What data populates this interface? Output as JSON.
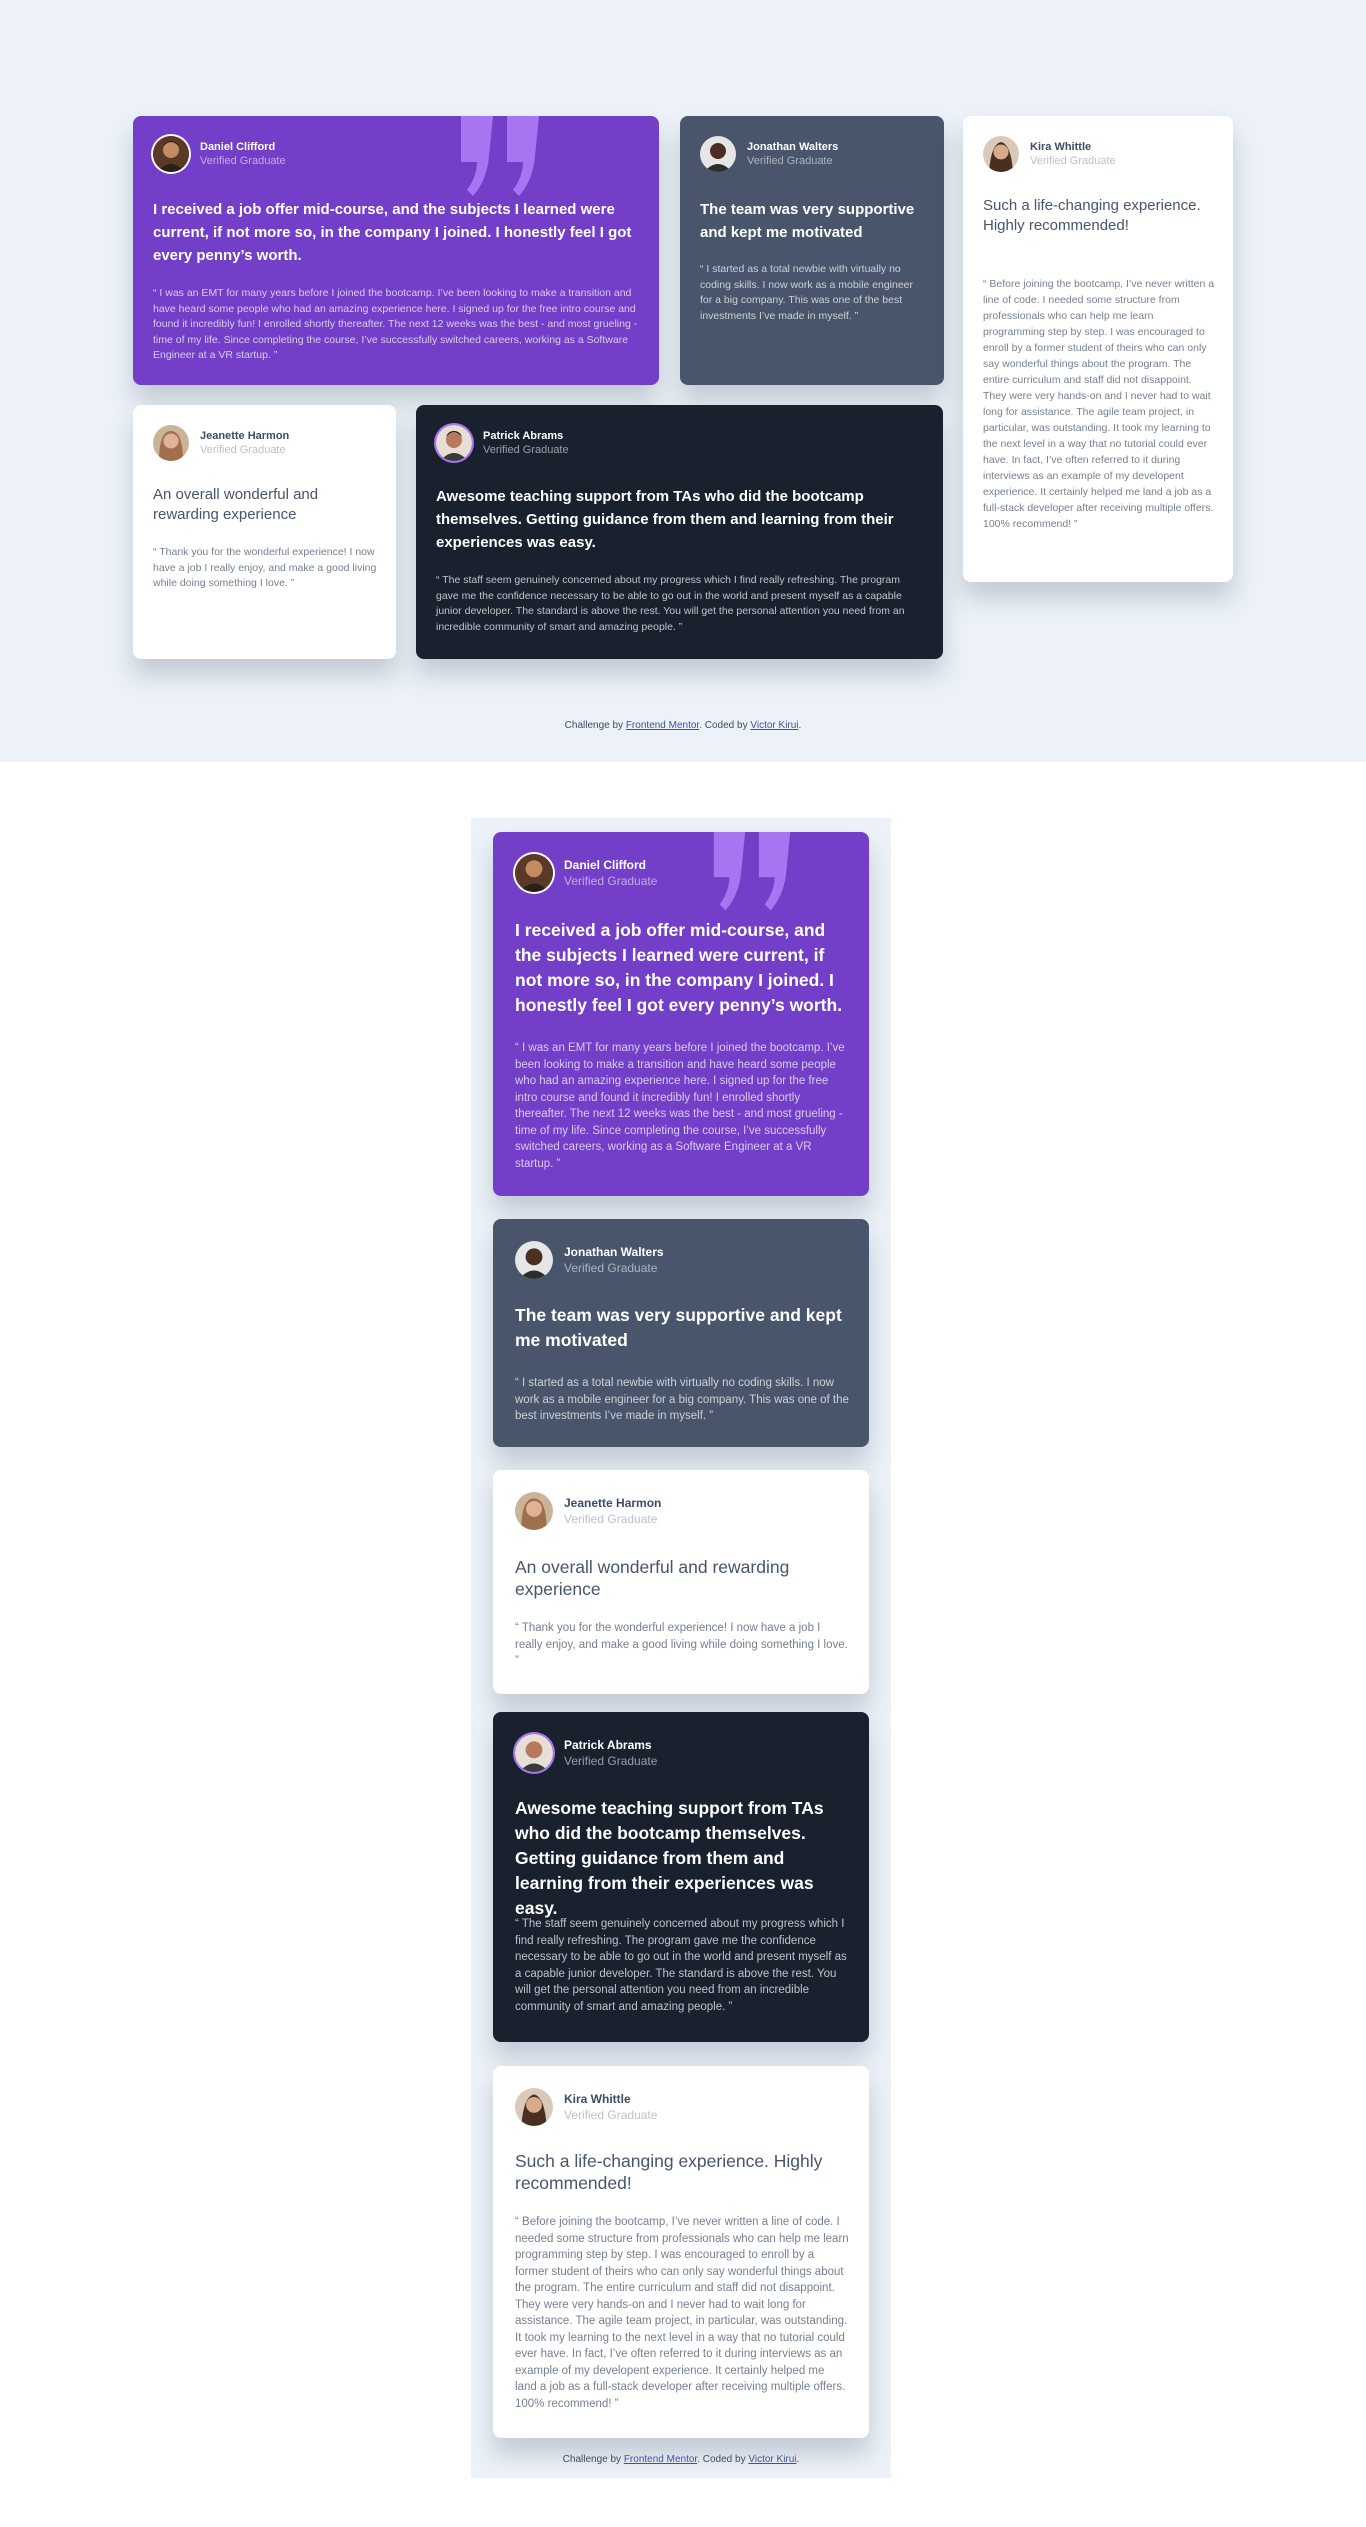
{
  "stray_mark": "\\",
  "testimonials": [
    {
      "name": "Daniel Clifford",
      "role": "Verified Graduate",
      "headline": "I received a job offer mid-course, and the subjects I learned were current, if not more so, in the company I joined. I honestly feel I got every penny’s worth.",
      "quote": "“ I was an EMT for many years before I joined the bootcamp. I’ve been looking to make a transition and have heard some people who had an amazing experience here. I signed up for the free intro course and found it incredibly fun! I enrolled shortly thereafter. The next 12 weeks was the best - and most grueling - time of my life. Since completing the course, I’ve successfully switched careers, working as a Software Engineer at a VR startup. ”"
    },
    {
      "name": "Jonathan Walters",
      "role": "Verified Graduate",
      "headline": "The team was very supportive and kept me motivated",
      "quote": "“ I started as a total newbie with virtually no coding skills. I now work as a mobile engineer for a big company. This was one of the best investments I’ve made in myself. ”"
    },
    {
      "name": "Jeanette Harmon",
      "role": "Verified Graduate",
      "headline": "An overall wonderful and rewarding experience",
      "quote": "“ Thank you for the wonderful experience! I now have a job I really enjoy, and make a good living while doing something I love. ”"
    },
    {
      "name": "Patrick Abrams",
      "role": "Verified Graduate",
      "headline": "Awesome teaching support from TAs who did the bootcamp themselves. Getting guidance from them and learning from their experiences was easy.",
      "quote": "“ The staff seem genuinely concerned about my progress which I find really refreshing. The program gave me the confidence necessary to be able to go out in the world and present myself as a capable junior developer. The standard is above the rest. You will get the personal attention you need from an incredible community of smart and amazing people. ”"
    },
    {
      "name": "Kira Whittle",
      "role": "Verified Graduate",
      "headline": "Such a life-changing experience. Highly recommended!",
      "quote": "“ Before joining the bootcamp, I’ve never written a line of code. I needed some structure from professionals who can help me learn programming step by step. I was encouraged to enroll by a former student of theirs who can only say wonderful things about the program. The entire curriculum and staff did not disappoint. They were very hands-on and I never had to wait long for assistance. The agile team project, in particular, was outstanding. It took my learning to the next level in a way that no tutorial could ever have. In fact, I’ve often referred to it during interviews as an example of my developent experience. It certainly helped me land a job as a full-stack developer after receiving multiple offers. 100% recommend! ”"
    }
  ],
  "attribution": {
    "prefix": "Challenge by ",
    "link1": "Frontend Mentor",
    "middle": ". Coded by ",
    "link2": "Victor Kirui",
    "suffix": "."
  },
  "colors": {
    "page_bg": "#ecf2f8",
    "violet": "#733fc8",
    "slate": "#48556a",
    "dark": "#19212e",
    "white": "#ffffff",
    "quote_mark": "#a775f1"
  },
  "icons": {
    "quote": "quotation-mark-icon",
    "avatar": "user-avatar-icon"
  }
}
